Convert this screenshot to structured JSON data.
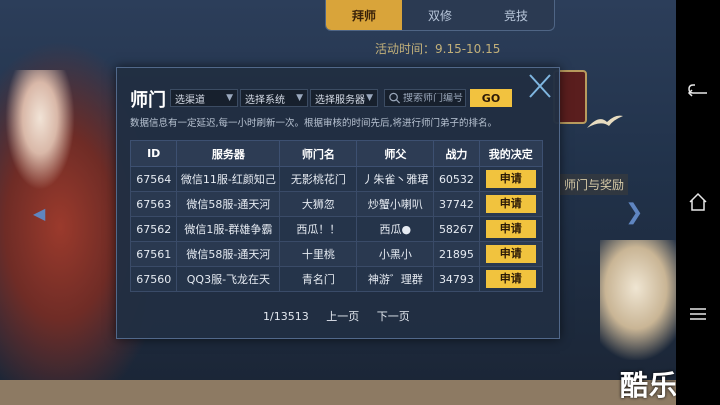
{
  "top_tabs": [
    {
      "label": "拜师",
      "active": true
    },
    {
      "label": "双修",
      "active": false
    },
    {
      "label": "竞技",
      "active": false
    }
  ],
  "activity_time": "活动时间：9.15-10.15",
  "side_label": "师门与奖励",
  "dialog": {
    "title": "师门",
    "filters": {
      "channel": "选渠道",
      "system": "选择系统",
      "server": "选择服务器"
    },
    "search_placeholder": "搜索师门编号",
    "go_label": "GO",
    "notice": "数据信息有一定延迟,每一小时刷新一次。根据审核的时间先后,将进行师门弟子的排名。",
    "columns": [
      "ID",
      "服务器",
      "师门名",
      "师父",
      "战力",
      "我的决定"
    ],
    "rows": [
      {
        "id": "67564",
        "server": "微信11服-红颜知己",
        "sect": "无影桃花门",
        "master": "丿朱雀丶雅珺",
        "power": "60532",
        "action": "申请"
      },
      {
        "id": "67563",
        "server": "微信58服-通天河",
        "sect": "大狮忽",
        "master": "炒蟹小喇叭",
        "power": "37742",
        "action": "申请"
      },
      {
        "id": "67562",
        "server": "微信1服-群雄争霸",
        "sect": "西瓜！！",
        "master": "西瓜●",
        "power": "58267",
        "action": "申请"
      },
      {
        "id": "67561",
        "server": "微信58服-通天河",
        "sect": "十里桃",
        "master": "小黑小",
        "power": "21895",
        "action": "申请"
      },
      {
        "id": "67560",
        "server": "QQ3服-飞龙在天",
        "sect": "青名门",
        "master": "神游゛理群",
        "power": "34793",
        "action": "申请"
      }
    ],
    "pager": {
      "page": "1/13513",
      "prev": "上一页",
      "next": "下一页"
    }
  },
  "watermark": "酷乐米",
  "colors": {
    "accent": "#f1c33e",
    "dialog_bg": "#212e42",
    "table_cell": "#25344a"
  },
  "icons": {
    "close": "close-icon",
    "search": "search-icon",
    "back": "back-icon",
    "home": "home-icon",
    "menu": "menu-icon"
  }
}
